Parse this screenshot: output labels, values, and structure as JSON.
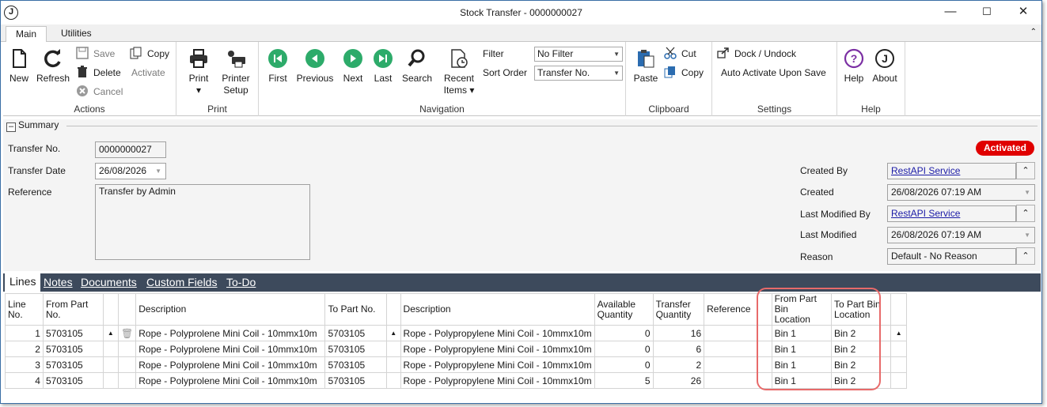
{
  "window": {
    "title": "Stock Transfer - 0000000027"
  },
  "ribbon_tabs": [
    "Main",
    "Utilities"
  ],
  "ribbon": {
    "actions": {
      "new": "New",
      "refresh": "Refresh",
      "save": "Save",
      "delete": "Delete",
      "cancel": "Cancel",
      "copy": "Copy",
      "activate": "Activate",
      "group": "Actions"
    },
    "print": {
      "print": "Print",
      "printer_setup_1": "Printer",
      "printer_setup_2": "Setup",
      "group": "Print"
    },
    "navigation": {
      "first": "First",
      "previous": "Previous",
      "next": "Next",
      "last": "Last",
      "search": "Search",
      "recent_1": "Recent",
      "recent_2": "Items",
      "filter_label": "Filter",
      "filter_value": "No Filter",
      "sort_label": "Sort Order",
      "sort_value": "Transfer No.",
      "group": "Navigation"
    },
    "clipboard": {
      "paste": "Paste",
      "cut": "Cut",
      "copy": "Copy",
      "group": "Clipboard"
    },
    "settings": {
      "dock": "Dock / Undock",
      "auto_activate": "Auto Activate Upon Save",
      "group": "Settings"
    },
    "help": {
      "help": "Help",
      "about": "About",
      "group": "Help"
    }
  },
  "summary": {
    "heading": "Summary",
    "transfer_no_label": "Transfer No.",
    "transfer_no": "0000000027",
    "transfer_date_label": "Transfer Date",
    "transfer_date": "26/08/2026",
    "reference_label": "Reference",
    "reference": "Transfer by Admin",
    "status": "Activated",
    "created_by_label": "Created By",
    "created_by": "RestAPI Service",
    "created_label": "Created",
    "created": "26/08/2026 07:19 AM",
    "last_modified_by_label": "Last Modified By",
    "last_modified_by": "RestAPI Service",
    "last_modified_label": "Last Modified",
    "last_modified": "26/08/2026 07:19 AM",
    "reason_label": "Reason",
    "reason": "Default - No Reason"
  },
  "line_tabs": [
    "Lines",
    "Notes",
    "Documents",
    "Custom Fields",
    "To-Do"
  ],
  "grid": {
    "headers": {
      "line_no": "Line No.",
      "from_part": "From Part No.",
      "desc1": "Description",
      "to_part": "To Part No.",
      "desc2": "Description",
      "avail_1": "Available",
      "avail_2": "Quantity",
      "transfer_1": "Transfer",
      "transfer_2": "Quantity",
      "reference": "Reference",
      "from_bin_1": "From Part Bin",
      "from_bin_2": "Location",
      "to_bin_1": "To Part Bin",
      "to_bin_2": "Location"
    },
    "rows": [
      {
        "line": "1",
        "from_part": "5703105",
        "desc1": "Rope - Polyprolene Mini Coil - 10mmx10m",
        "to_part": "5703105",
        "desc2": "Rope - Polypropylene Mini Coil - 10mmx10m",
        "available": "0",
        "transfer": "16",
        "reference": "",
        "from_bin": "Bin 1",
        "to_bin": "Bin 2"
      },
      {
        "line": "2",
        "from_part": "5703105",
        "desc1": "Rope - Polyprolene Mini Coil - 10mmx10m",
        "to_part": "5703105",
        "desc2": "Rope - Polypropylene Mini Coil - 10mmx10m",
        "available": "0",
        "transfer": "6",
        "reference": "",
        "from_bin": "Bin 1",
        "to_bin": "Bin 2"
      },
      {
        "line": "3",
        "from_part": "5703105",
        "desc1": "Rope - Polyprolene Mini Coil - 10mmx10m",
        "to_part": "5703105",
        "desc2": "Rope - Polypropylene Mini Coil - 10mmx10m",
        "available": "0",
        "transfer": "2",
        "reference": "",
        "from_bin": "Bin 1",
        "to_bin": "Bin 2"
      },
      {
        "line": "4",
        "from_part": "5703105",
        "desc1": "Rope - Polyprolene Mini Coil - 10mmx10m",
        "to_part": "5703105",
        "desc2": "Rope - Polypropylene Mini Coil - 10mmx10m",
        "available": "5",
        "transfer": "26",
        "reference": "",
        "from_bin": "Bin 1",
        "to_bin": "Bin 2"
      }
    ]
  },
  "colors": {
    "accent": "#2dab6a",
    "status_red": "#e00000",
    "tabbar": "#3d4a5c",
    "highlight": "#e86a6a"
  }
}
